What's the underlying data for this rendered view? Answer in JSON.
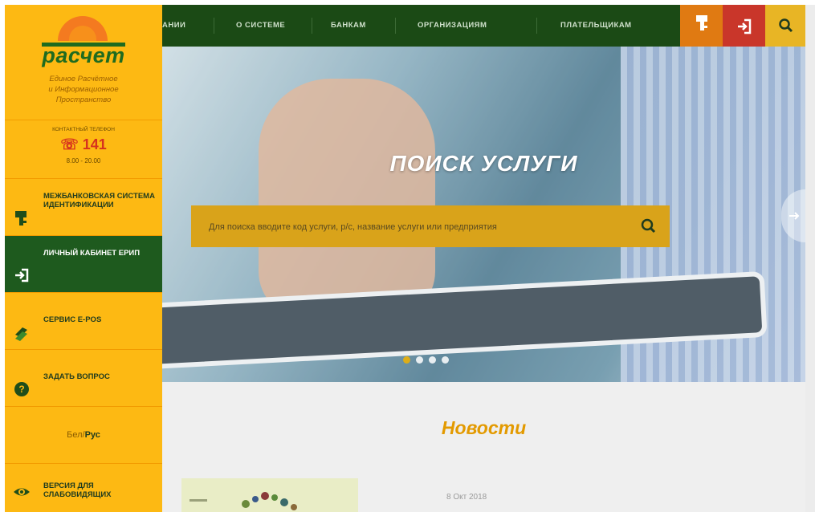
{
  "sidebar": {
    "logo": {
      "name": "расчет",
      "tagline": [
        "Единое Расчётное",
        "и Информационное",
        "Пространство"
      ]
    },
    "contact": {
      "caption": "контактный телефон",
      "phone": "141",
      "hours": "8.00 - 20.00"
    },
    "items": [
      {
        "label": "МЕЖБАНКОВСКАЯ СИСТЕМА ИДЕНТИФИКАЦИИ",
        "icon": "key-icon"
      },
      {
        "label": "ЛИЧНЫЙ КАБИНЕТ ЕРИП",
        "icon": "login-icon"
      },
      {
        "label": "СЕРВИС E-POS",
        "icon": "epos-icon"
      },
      {
        "label": "ЗАДАТЬ ВОПРОС",
        "icon": "question-icon"
      }
    ],
    "language": {
      "bel": "Бел",
      "sep": "/",
      "rus": "Рус"
    },
    "accessibility": {
      "label": "ВЕРСИЯ ДЛЯ СЛАБОВИДЯЩИХ",
      "icon": "eye-icon"
    }
  },
  "topnav": {
    "items": [
      "АНИИ",
      "О СИСТЕМЕ",
      "БАНКАМ",
      "ОРГАНИЗАЦИЯМ",
      "ПЛАТЕЛЬЩИКАМ"
    ],
    "buttons": {
      "mci_icon": "key-icon",
      "login_icon": "login-icon",
      "search_icon": "search-icon"
    }
  },
  "hero": {
    "title": "ПОИСК УСЛУГИ",
    "search_placeholder": "Для поиска вводите код услуги, р/с, название услуги или предприятия",
    "slides_total": 4,
    "slide_active": 1
  },
  "news": {
    "title": "Новости",
    "first_date": "8 Окт 2018"
  },
  "colors": {
    "accent": "#fdb913",
    "dark_green": "#1b4a15",
    "search_bg": "#d9a31a",
    "news_title": "#e39a00",
    "login_red": "#c9362a"
  }
}
